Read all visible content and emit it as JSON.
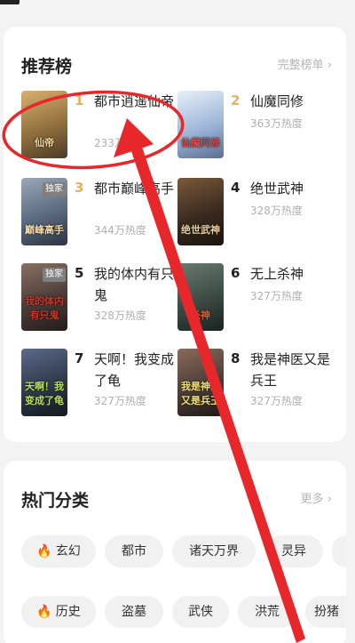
{
  "recommend": {
    "title": "推荐榜",
    "more": "完整榜单 ›",
    "books": [
      {
        "rank": "1",
        "title": "都市逍遥仙帝",
        "heat": "233万热度",
        "badge": "",
        "cover_text": "仙帝",
        "cover_bg": "#b08850"
      },
      {
        "rank": "2",
        "title": "仙魔同修",
        "heat": "363万热度",
        "badge": "",
        "cover_text": "仙魔同修",
        "cover_bg": "#9db6d8"
      },
      {
        "rank": "3",
        "title": "都市巅峰高手",
        "heat": "344万热度",
        "badge": "独家",
        "cover_text": "巅峰高手",
        "cover_bg": "#5f6f84"
      },
      {
        "rank": "4",
        "title": "绝世武神",
        "heat": "328万热度",
        "badge": "",
        "cover_text": "绝世武神",
        "cover_bg": "#3a2a20"
      },
      {
        "rank": "5",
        "title": "我的体内有只鬼",
        "heat": "328万热度",
        "badge": "独家",
        "cover_text": "我的体内有只鬼",
        "cover_bg": "#4a3c3a"
      },
      {
        "rank": "6",
        "title": "无上杀神",
        "heat": "327万热度",
        "badge": "",
        "cover_text": "杀神",
        "cover_bg": "#3c4a44"
      },
      {
        "rank": "7",
        "title": "天啊！我变成了龟",
        "heat": "327万热度",
        "badge": "",
        "cover_text": "天啊！我变成了龟",
        "cover_bg": "#2f3a4a"
      },
      {
        "rank": "8",
        "title": "我是神医又是兵王",
        "heat": "327万热度",
        "badge": "",
        "cover_text": "我是神医又是兵王",
        "cover_bg": "#4a3d38"
      }
    ]
  },
  "categories": {
    "title": "热门分类",
    "more": "更多 ›",
    "row1": [
      {
        "label": "玄幻",
        "hot": true
      },
      {
        "label": "都市",
        "hot": false
      },
      {
        "label": "诸天万界",
        "hot": false
      },
      {
        "label": "灵异",
        "hot": false
      }
    ],
    "row2": [
      {
        "label": "历史",
        "hot": true
      },
      {
        "label": "盗墓",
        "hot": false
      },
      {
        "label": "武侠",
        "hot": false
      },
      {
        "label": "洪荒",
        "hot": false
      },
      {
        "label": "扮猪",
        "hot": false
      }
    ]
  },
  "colors": {
    "accent": "#e7b061",
    "annotation": "#e8272a",
    "flame": "#ef6b3c"
  }
}
